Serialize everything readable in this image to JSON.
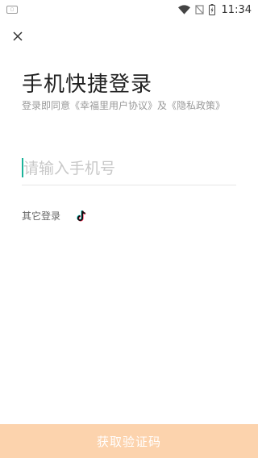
{
  "status_bar": {
    "time": "11:34",
    "icons": [
      "wifi-icon",
      "no-signal-icon",
      "battery-charging-icon"
    ]
  },
  "close_icon": "close-icon",
  "title": "手机快捷登录",
  "agreement": {
    "prefix": "登录即同意",
    "user_agreement": "《幸福里用户协议》",
    "conjunction": "及",
    "privacy_policy": "《隐私政策》"
  },
  "phone": {
    "placeholder": "请输入手机号",
    "value": ""
  },
  "other_login": {
    "label": "其它登录",
    "providers": [
      "tiktok-icon"
    ]
  },
  "submit": {
    "label": "获取验证码"
  },
  "colors": {
    "accent": "#1bb39a",
    "button_bg": "#fcd3ad",
    "muted_text": "#999999"
  }
}
